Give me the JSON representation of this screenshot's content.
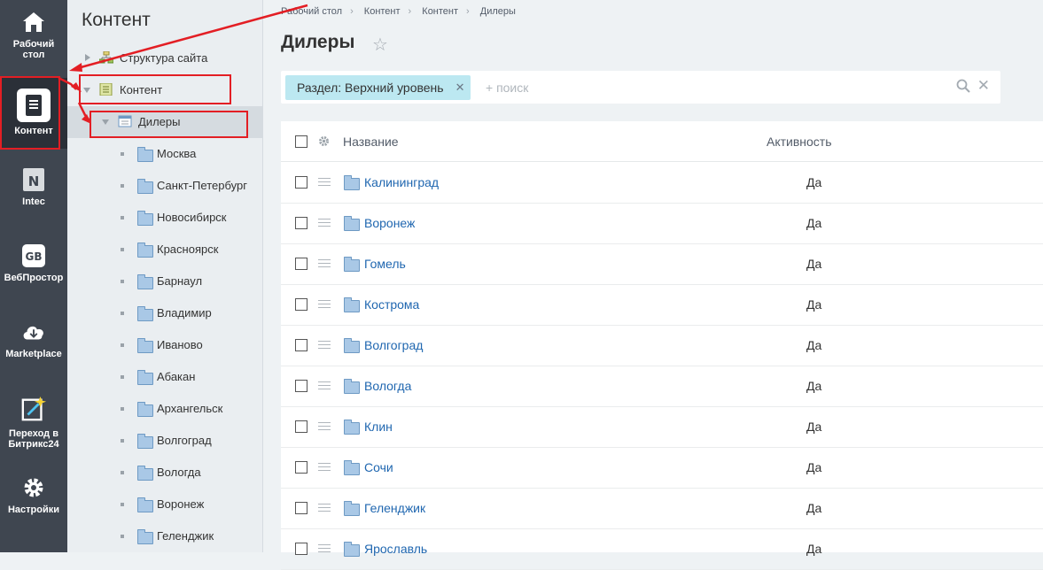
{
  "leftnav": {
    "items": [
      {
        "label": "Рабочий стол",
        "icon": "home-icon"
      },
      {
        "label": "Контент",
        "icon": "document-icon"
      },
      {
        "label": "Intec",
        "icon": "intec-logo-icon"
      },
      {
        "label": "ВебПростор",
        "icon": "webprostor-logo-icon"
      },
      {
        "label": "Marketplace",
        "icon": "cloud-download-icon"
      },
      {
        "label": "Переход в Битрикс24",
        "icon": "magic-wand-icon"
      },
      {
        "label": "Настройки",
        "icon": "gear-icon"
      }
    ]
  },
  "tree": {
    "title": "Контент",
    "root_items": [
      {
        "label": "Структура сайта"
      },
      {
        "label": "Контент"
      },
      {
        "label": "Дилеры"
      }
    ],
    "cities": [
      "Москва",
      "Санкт-Петербург",
      "Новосибирск",
      "Красноярск",
      "Барнаул",
      "Владимир",
      "Иваново",
      "Абакан",
      "Архангельск",
      "Волгоград",
      "Вологда",
      "Воронеж",
      "Геленджик"
    ]
  },
  "breadcrumbs": [
    "Рабочий стол",
    "Контент",
    "Контент",
    "Дилеры"
  ],
  "page": {
    "title": "Дилеры"
  },
  "filter": {
    "chip_label": "Раздел: Верхний уровень",
    "search_placeholder": "+ поиск"
  },
  "grid": {
    "columns": {
      "name": "Название",
      "activity": "Активность"
    },
    "rows": [
      {
        "name": "Калининград",
        "activity": "Да"
      },
      {
        "name": "Воронеж",
        "activity": "Да"
      },
      {
        "name": "Гомель",
        "activity": "Да"
      },
      {
        "name": "Кострома",
        "activity": "Да"
      },
      {
        "name": "Волгоград",
        "activity": "Да"
      },
      {
        "name": "Вологда",
        "activity": "Да"
      },
      {
        "name": "Клин",
        "activity": "Да"
      },
      {
        "name": "Сочи",
        "activity": "Да"
      },
      {
        "name": "Геленджик",
        "activity": "Да"
      },
      {
        "name": "Ярославль",
        "activity": "Да"
      }
    ]
  },
  "colors": {
    "annotation_red": "#e31e24",
    "link_blue": "#2067b0",
    "chip_bg": "#bce8f1",
    "nav_bg": "#3f4650"
  }
}
